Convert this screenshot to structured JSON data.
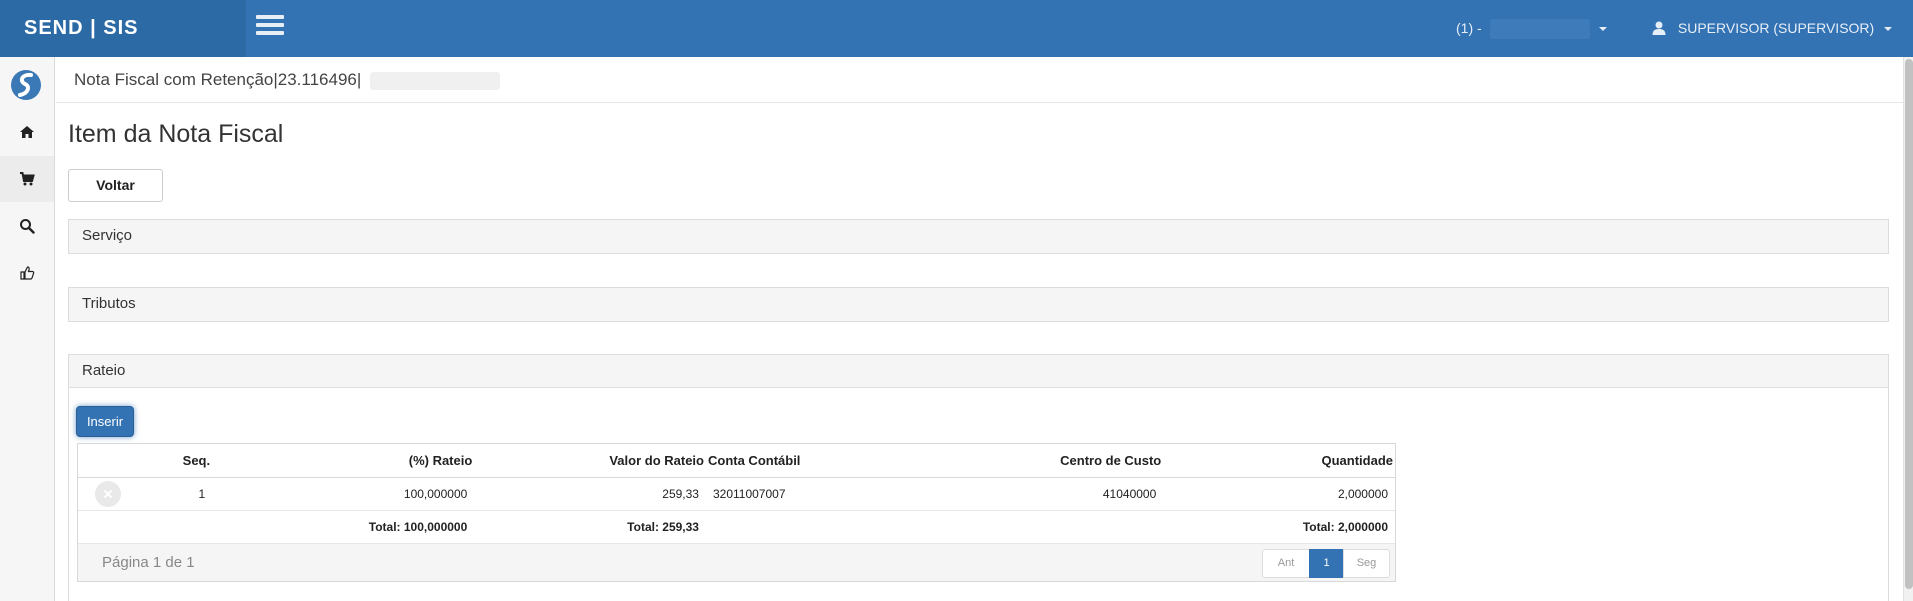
{
  "app": {
    "brand": "SEND | SIS"
  },
  "header": {
    "company_label": "(1) -",
    "user_label": "SUPERVISOR (SUPERVISOR)"
  },
  "breadcrumb": {
    "text": "Nota Fiscal com Retenção|23.116496|"
  },
  "page": {
    "title": "Item da Nota Fiscal",
    "back_label": "Voltar"
  },
  "sidebar": {
    "items": [
      {
        "name": "home",
        "icon": "home-icon"
      },
      {
        "name": "cart",
        "icon": "shopping-cart-icon"
      },
      {
        "name": "search",
        "icon": "search-icon"
      },
      {
        "name": "thumbs-up",
        "icon": "thumbs-up-icon"
      }
    ]
  },
  "panels": {
    "servico": "Serviço",
    "tributos": "Tributos",
    "rateio": "Rateio"
  },
  "rateio": {
    "insert_label": "Inserir",
    "columns": {
      "seq": "Seq.",
      "rateio": "(%) Rateio",
      "valor": "Valor do Rateio",
      "conta": "Conta Contábil",
      "centro": "Centro de Custo",
      "quantidade": "Quantidade"
    },
    "rows": [
      {
        "seq": "1",
        "rateio": "100,000000",
        "valor": "259,33",
        "conta": "32011007007",
        "centro": "41040000",
        "quantidade": "2,000000"
      }
    ],
    "totals": {
      "rateio": "Total: 100,000000",
      "valor": "Total: 259,33",
      "quantidade": "Total: 2,000000"
    },
    "pager": {
      "info": "Página 1 de 1",
      "prev": "Ant",
      "current": "1",
      "next": "Seg"
    }
  },
  "colors": {
    "primary": "#3372b3",
    "brand_bg": "#2c6aa6",
    "panel_bg": "#f5f5f5"
  }
}
